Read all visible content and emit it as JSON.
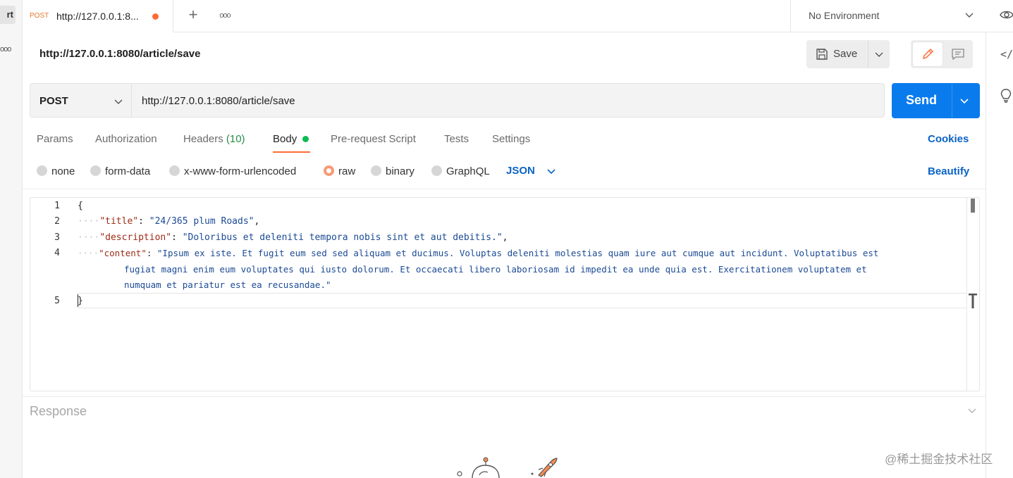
{
  "sidebar": {
    "import_label": "rt",
    "more_glyph": "ooo"
  },
  "tabs": [
    {
      "method": "POST",
      "title": "http://127.0.0.1:8...",
      "unsaved": true
    }
  ],
  "tabbar": {
    "add_glyph": "+",
    "more_glyph": "ooo"
  },
  "environment": {
    "selected": "No Environment"
  },
  "request": {
    "name": "http://127.0.0.1:8080/article/save",
    "method": "POST",
    "url": "http://127.0.0.1:8080/article/save"
  },
  "toolbar": {
    "save_label": "Save",
    "send_label": "Send"
  },
  "request_tabs": [
    {
      "label": "Params"
    },
    {
      "label": "Authorization"
    },
    {
      "label": "Headers",
      "count": "(10)"
    },
    {
      "label": "Body",
      "active": true,
      "indicator_color": "#0cbb52"
    },
    {
      "label": "Pre-request Script"
    },
    {
      "label": "Tests"
    },
    {
      "label": "Settings"
    }
  ],
  "cookies_label": "Cookies",
  "body_types": [
    {
      "label": "none",
      "selected": false
    },
    {
      "label": "form-data",
      "selected": false
    },
    {
      "label": "x-www-form-urlencoded",
      "selected": false
    },
    {
      "label": "raw",
      "selected": true
    },
    {
      "label": "binary",
      "selected": false
    },
    {
      "label": "GraphQL",
      "selected": false
    }
  ],
  "raw_format": "JSON",
  "beautify_label": "Beautify",
  "editor": {
    "lines": [
      {
        "n": "1",
        "open": "{"
      },
      {
        "n": "2",
        "key": "\"title\"",
        "value": "\"24/365 plum Roads\"",
        "tail": ","
      },
      {
        "n": "3",
        "key": "\"description\"",
        "value": "\"Doloribus et deleniti tempora nobis sint et aut debitis.\"",
        "tail": ","
      },
      {
        "n": "4",
        "key": "\"content\"",
        "value_line1": "\"Ipsum ex iste. Et fugit eum sed sed aliquam et ducimus. Voluptas deleniti molestias quam iure aut cumque aut incidunt. Voluptatibus est",
        "value_line2": "fugiat magni enim eum voluptates qui iusto dolorum. Et occaecati libero laboriosam id impedit ea unde quia est. Exercitationem voluptatem et",
        "value_line3": "numquam et pariatur est ea recusandae.\""
      },
      {
        "n": "5",
        "close": "}"
      }
    ]
  },
  "response": {
    "label": "Response"
  },
  "watermark": "@稀土掘金技术社区",
  "colors": {
    "accent": "#ff6c37",
    "send": "#097bed",
    "link": "#0b63c5",
    "json_key": "#9d2b16",
    "json_string": "#1b4a94"
  }
}
